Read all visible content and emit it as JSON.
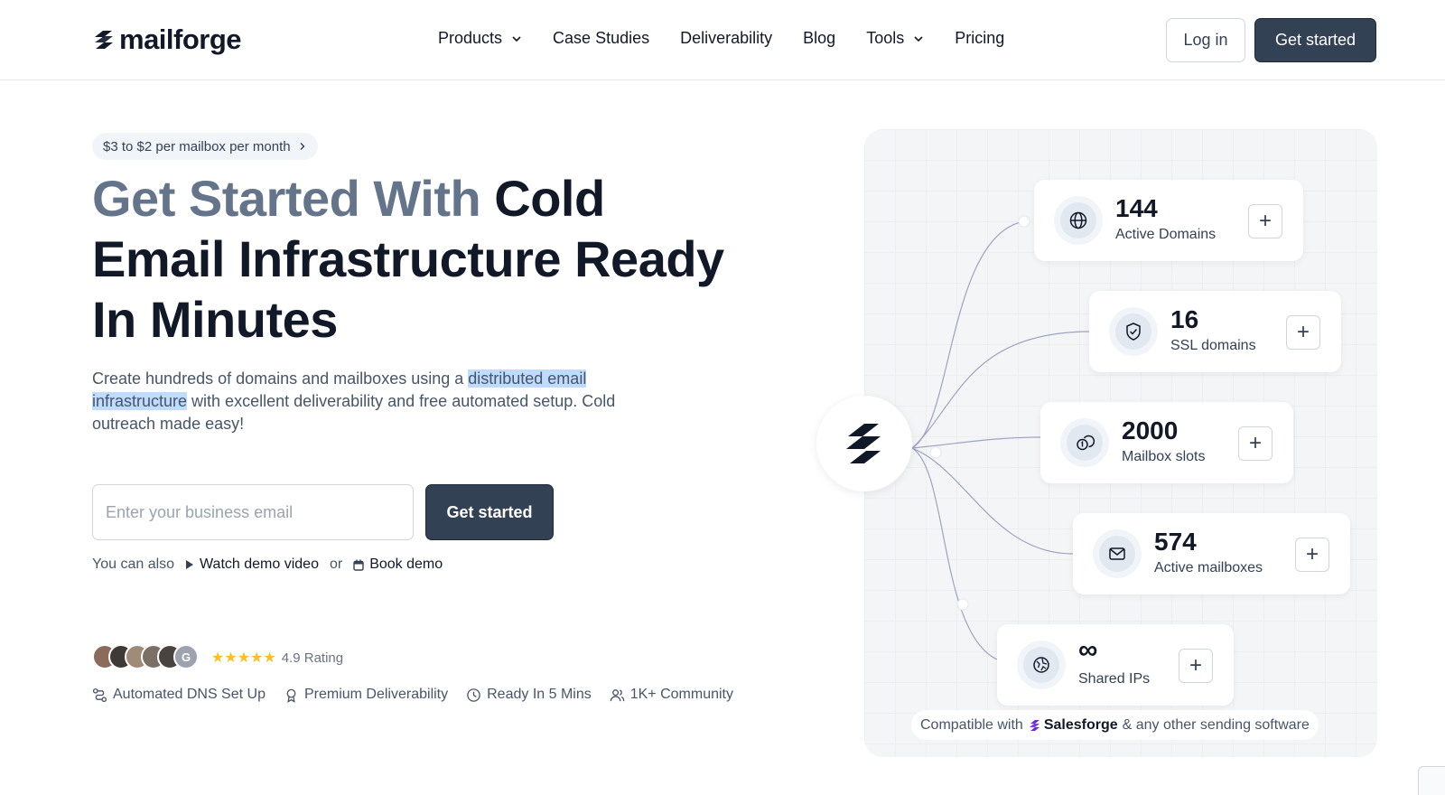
{
  "header": {
    "logo_text": "mailforge",
    "nav": [
      {
        "label": "Products",
        "has_dropdown": true
      },
      {
        "label": "Case Studies",
        "has_dropdown": false
      },
      {
        "label": "Deliverability",
        "has_dropdown": false
      },
      {
        "label": "Blog",
        "has_dropdown": false
      },
      {
        "label": "Tools",
        "has_dropdown": true
      },
      {
        "label": "Pricing",
        "has_dropdown": false
      }
    ],
    "login_label": "Log in",
    "get_started_label": "Get started"
  },
  "hero": {
    "pill_text": "$3 to $2 per mailbox per month",
    "title_muted": "Get Started With ",
    "title_main": "Cold Email Infrastructure Ready In Minutes",
    "subtitle_before": "Create hundreds of domains and mailboxes using a ",
    "subtitle_highlight": "distributed email infrastructure",
    "subtitle_after": " with excellent deliverability and free automated setup. Cold outreach made easy!",
    "email_placeholder": "Enter your business email",
    "email_value": "",
    "cta_label": "Get started",
    "also_text": "You can also",
    "watch_demo": "Watch demo video",
    "or_text": "or",
    "book_demo": "Book demo",
    "rating_stars": "★★★★★",
    "rating_text": "4.9 Rating",
    "features": [
      {
        "icon": "route-icon",
        "label": "Automated DNS Set Up"
      },
      {
        "icon": "award-icon",
        "label": "Premium Deliverability"
      },
      {
        "icon": "clock-icon",
        "label": "Ready In 5 Mins"
      },
      {
        "icon": "users-icon",
        "label": "1K+ Community"
      }
    ]
  },
  "stats": [
    {
      "value": "144",
      "label": "Active Domains",
      "icon": "globe-icon"
    },
    {
      "value": "16",
      "label": "SSL domains",
      "icon": "shield-check-icon"
    },
    {
      "value": "2000",
      "label": "Mailbox slots",
      "icon": "coins-icon"
    },
    {
      "value": "574",
      "label": "Active mailboxes",
      "icon": "mail-icon"
    },
    {
      "value": "∞",
      "label": "Shared IPs",
      "icon": "network-icon"
    }
  ],
  "compat": {
    "prefix": "Compatible with",
    "brand": "Salesforge",
    "suffix": "& any other sending software"
  },
  "colors": {
    "primary": "#334155",
    "title_muted": "#64748b",
    "highlight": "#bfdbfe",
    "star": "#fbbf24",
    "salesforge_purple": "#6d28d9"
  }
}
